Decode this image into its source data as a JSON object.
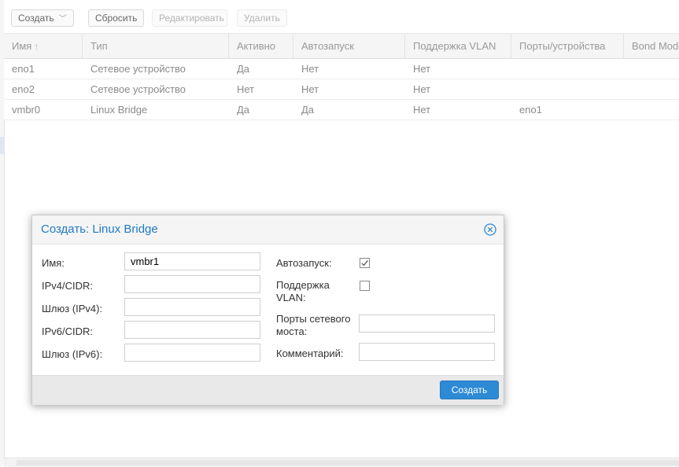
{
  "toolbar": {
    "create_label": "Создать",
    "reset_label": "Сбросить",
    "edit_label": "Редактировать",
    "delete_label": "Удалить"
  },
  "grid": {
    "columns": [
      "Имя",
      "Тип",
      "Активно",
      "Автозапуск",
      "Поддержка VLAN",
      "Порты/устройства",
      "Bond Mode"
    ],
    "rows": [
      [
        "eno1",
        "Сетевое устройство",
        "Да",
        "Нет",
        "Нет",
        ""
      ],
      [
        "eno2",
        "Сетевое устройство",
        "Нет",
        "Нет",
        "Нет",
        ""
      ],
      [
        "vmbr0",
        "Linux Bridge",
        "Да",
        "Да",
        "Нет",
        "eno1"
      ]
    ]
  },
  "dialog": {
    "title": "Создать: Linux Bridge",
    "name_label": "Имя:",
    "name_value": "vmbr1",
    "ipv4_label": "IPv4/CIDR:",
    "ipv4_value": "",
    "gw4_label": "Шлюз (IPv4):",
    "gw4_value": "",
    "ipv6_label": "IPv6/CIDR:",
    "ipv6_value": "",
    "gw6_label": "Шлюз (IPv6):",
    "gw6_value": "",
    "autostart_label": "Автозапуск:",
    "autostart_checked": true,
    "vlan_label_1": "Поддержка",
    "vlan_label_2": "VLAN:",
    "vlan_checked": false,
    "ports_label_1": "Порты сетевого",
    "ports_label_2": "моста:",
    "ports_value": "",
    "comment_label": "Комментарий:",
    "comment_value": "",
    "create_button": "Создать"
  },
  "colors": {
    "accent": "#2d8ad5",
    "title": "#1f7ac4"
  },
  "icons": {
    "close": "close-circle-icon",
    "sort": "sort-ascending-icon",
    "dropdown": "chevron-down-icon",
    "check": "checkmark-icon"
  }
}
